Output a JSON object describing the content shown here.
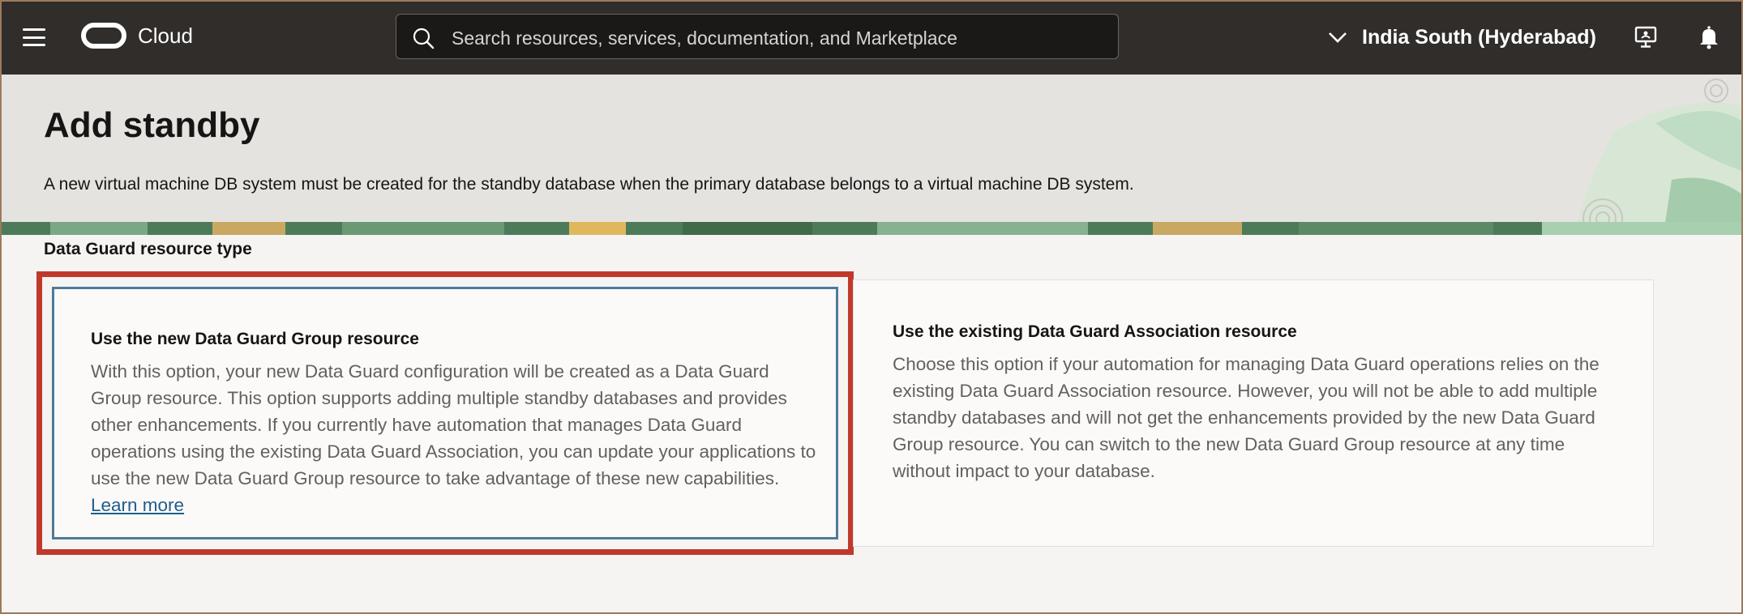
{
  "header": {
    "brand": "Cloud",
    "search_placeholder": "Search resources, services, documentation, and Marketplace",
    "region": "India South (Hyderabad)",
    "icons": [
      "menu-icon",
      "oracle-logo",
      "search-icon",
      "chevron-down-icon",
      "monitor-icon",
      "bell-icon"
    ]
  },
  "page": {
    "title": "Add standby",
    "description": "A new virtual machine DB system must be created for the standby database when the primary database belongs to a virtual machine DB system."
  },
  "section": {
    "label": "Data Guard resource type"
  },
  "options": [
    {
      "title": "Use the new Data Guard Group resource",
      "body": "With this option, your new Data Guard configuration will be created as a Data Guard Group resource. This option supports adding multiple standby databases and provides other enhancements. If you currently have automation that manages Data Guard operations using the existing Data Guard Association, you can update your applications to use the new Data Guard Group resource to take advantage of these new capabilities.",
      "link": "Learn more",
      "selected": true
    },
    {
      "title": "Use the existing Data Guard Association resource",
      "body": "Choose this option if your automation for managing Data Guard operations relies on the existing Data Guard Association resource. However, you will not be able to add multiple standby databases and will not get the enhancements provided by the new Data Guard Group resource. You can switch to the new Data Guard Group resource at any time without impact to your database.",
      "selected": false
    }
  ],
  "colors": {
    "topbar": "#312d2a",
    "banner": "#e5e3e0",
    "highlight": "#c0392b",
    "selected_border": "#4f7a9a",
    "link": "#1f5e8b"
  }
}
